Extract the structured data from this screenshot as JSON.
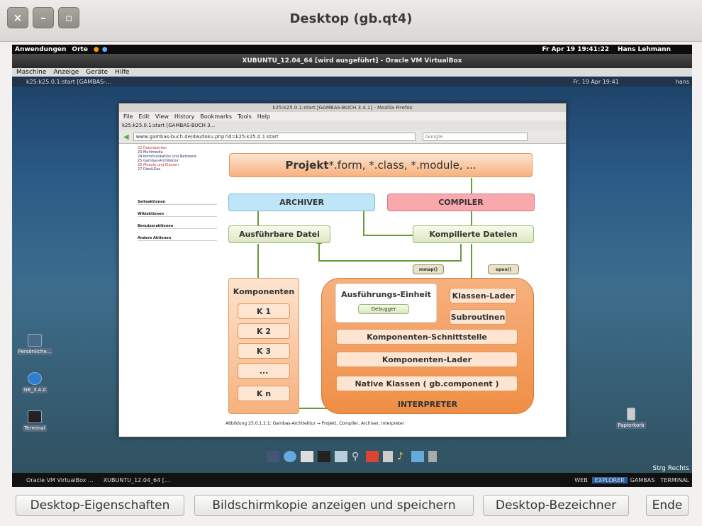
{
  "window": {
    "title": "Desktop (gb.qt4)",
    "close_glyph": "×",
    "minimize_glyph": "–",
    "maximize_glyph": "▫"
  },
  "host_panel": {
    "apps": "Anwendungen",
    "places": "Orte",
    "datetime": "Fr Apr 19 19:41:22",
    "user": "Hans Lehmann"
  },
  "vbox": {
    "title": "XUBUNTU_12.04_64 [wird ausgeführt] - Oracle VM VirtualBox",
    "menu": [
      "Maschine",
      "Anzeige",
      "Geräte",
      "Hilfe"
    ]
  },
  "guest_panel": {
    "task": "k25:k25.0.1:start [GAMBAS-...",
    "datetime": "Fr, 19 Apr 19:41",
    "user": "hans"
  },
  "firefox": {
    "title": "k25:k25.0.1:start [GAMBAS-BUCH 3.4.1] - Mozilla Firefox",
    "menu": [
      "File",
      "Edit",
      "View",
      "History",
      "Bookmarks",
      "Tools",
      "Help"
    ],
    "tab": "k25:k25.0.1:start [GAMBAS-BUCH 3...",
    "url": "www.gambas-buch.de/dw/doku.php?id=k25:k25.0.1:start",
    "search_placeholder": "Google",
    "side_links": [
      "22 Datenbanken",
      "23 Multimedia",
      "24 Kommunikation und Netzwerk",
      "25 Gambas-Architektur",
      "26 Module und Klassen",
      "27 Dies&Das"
    ],
    "side_sections": [
      "Seiteaktionen",
      "Wikiaktionen",
      "Benutzeraktionen",
      "Andere Aktionen"
    ],
    "caption": "Abbildung 25.0.1.2.1: Gambas-Architektur → Projekt, Compiler, Archiver, Interpreter"
  },
  "diagram": {
    "projekt_bold": "Projekt",
    "projekt_rest": " *.form, *.class, *.module, ...",
    "archiver": "ARCHIVER",
    "compiler": "COMPILER",
    "ausfuehrbare": "Ausführbare Datei",
    "kompilierte": "Kompilierte Dateien",
    "mmap": "mmap()",
    "open": "open()",
    "komponenten": "Komponenten",
    "k1": "K 1",
    "k2": "K 2",
    "k3": "K 3",
    "kdots": "...",
    "kn": "K n",
    "ausfuehrungs": "Ausführungs-Einheit",
    "debugger": "Debugger",
    "klassenlader": "Klassen-Lader",
    "subroutinen": "Subroutinen",
    "schnittstelle": "Komponenten-Schnittstelle",
    "komplader": "Komponenten-Lader",
    "native": "Native Klassen ( gb.component )",
    "interpreter": "INTERPRETER"
  },
  "desktop_icons": [
    "Persönliche...",
    "GB_3.4.0",
    "Terminal",
    "Papierkorb"
  ],
  "bottom_panel": {
    "task1": "Oracle VM VirtualBox ...",
    "task2": "XUBUNTU_12.04_64 [...",
    "tabs": [
      "WEB",
      "EXPLORER",
      "GAMBAS",
      "TERMINAL"
    ],
    "strg": "Strg Rechts"
  },
  "buttons": {
    "eigenschaften": "Desktop-Eigenschaften",
    "kopie": "Bildschirmkopie anzeigen und speichern",
    "bezeichner": "Desktop-Bezeichner",
    "ende": "Ende"
  },
  "colors": {
    "orange": "#f7b17e",
    "archiver": "#bfe6f8",
    "compiler": "#f9a8ad",
    "arrow": "#6a9a3a"
  }
}
